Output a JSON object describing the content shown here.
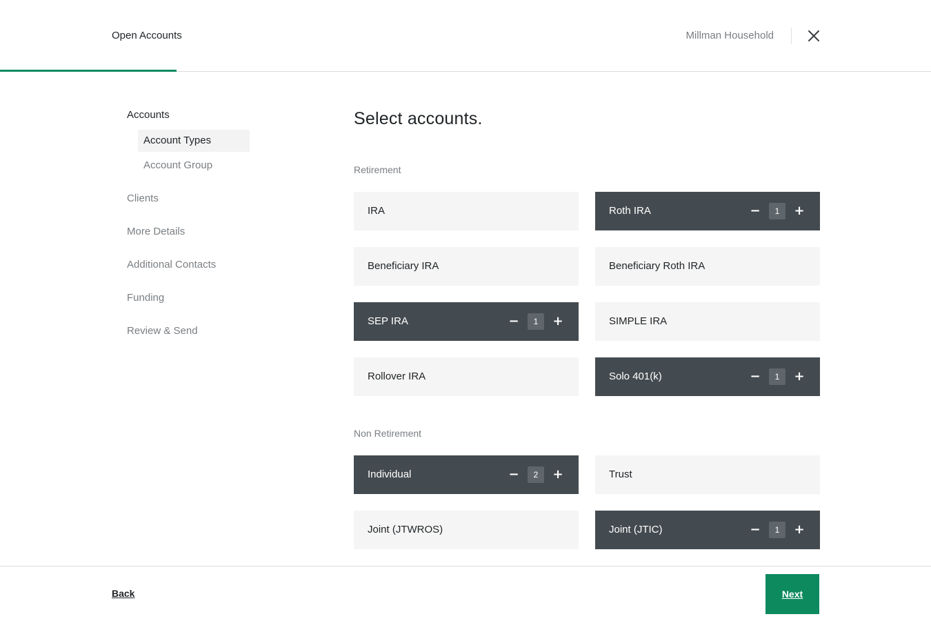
{
  "header": {
    "title": "Open Accounts",
    "household": "Millman Household",
    "close_icon": "close-icon",
    "progress_color": "#0e8a5f"
  },
  "sidebar": {
    "section": "Accounts",
    "sub_items": [
      {
        "label": "Account Types",
        "active": true
      },
      {
        "label": "Account Group",
        "active": false
      }
    ],
    "items": [
      {
        "label": "Clients"
      },
      {
        "label": "More Details"
      },
      {
        "label": "Additional Contacts"
      },
      {
        "label": "Funding"
      },
      {
        "label": "Review & Send"
      }
    ]
  },
  "main": {
    "title": "Select accounts.",
    "groups": [
      {
        "label": "Retirement",
        "accounts": [
          {
            "label": "IRA",
            "selected": false
          },
          {
            "label": "Roth IRA",
            "selected": true,
            "count": "1"
          },
          {
            "label": "Beneficiary IRA",
            "selected": false
          },
          {
            "label": "Beneficiary Roth IRA",
            "selected": false
          },
          {
            "label": "SEP IRA",
            "selected": true,
            "count": "1"
          },
          {
            "label": "SIMPLE IRA",
            "selected": false
          },
          {
            "label": "Rollover IRA",
            "selected": false
          },
          {
            "label": "Solo 401(k)",
            "selected": true,
            "count": "1"
          }
        ]
      },
      {
        "label": "Non Retirement",
        "accounts": [
          {
            "label": "Individual",
            "selected": true,
            "count": "2"
          },
          {
            "label": "Trust",
            "selected": false
          },
          {
            "label": "Joint (JTWROS)",
            "selected": false
          },
          {
            "label": "Joint (JTIC)",
            "selected": true,
            "count": "1"
          }
        ]
      }
    ],
    "stepper": {
      "minus": "−",
      "plus": "+"
    }
  },
  "footer": {
    "back_label": "Back",
    "next_label": "Next",
    "accent_color": "#0e8a5f",
    "selected_card_color": "#444b50"
  }
}
